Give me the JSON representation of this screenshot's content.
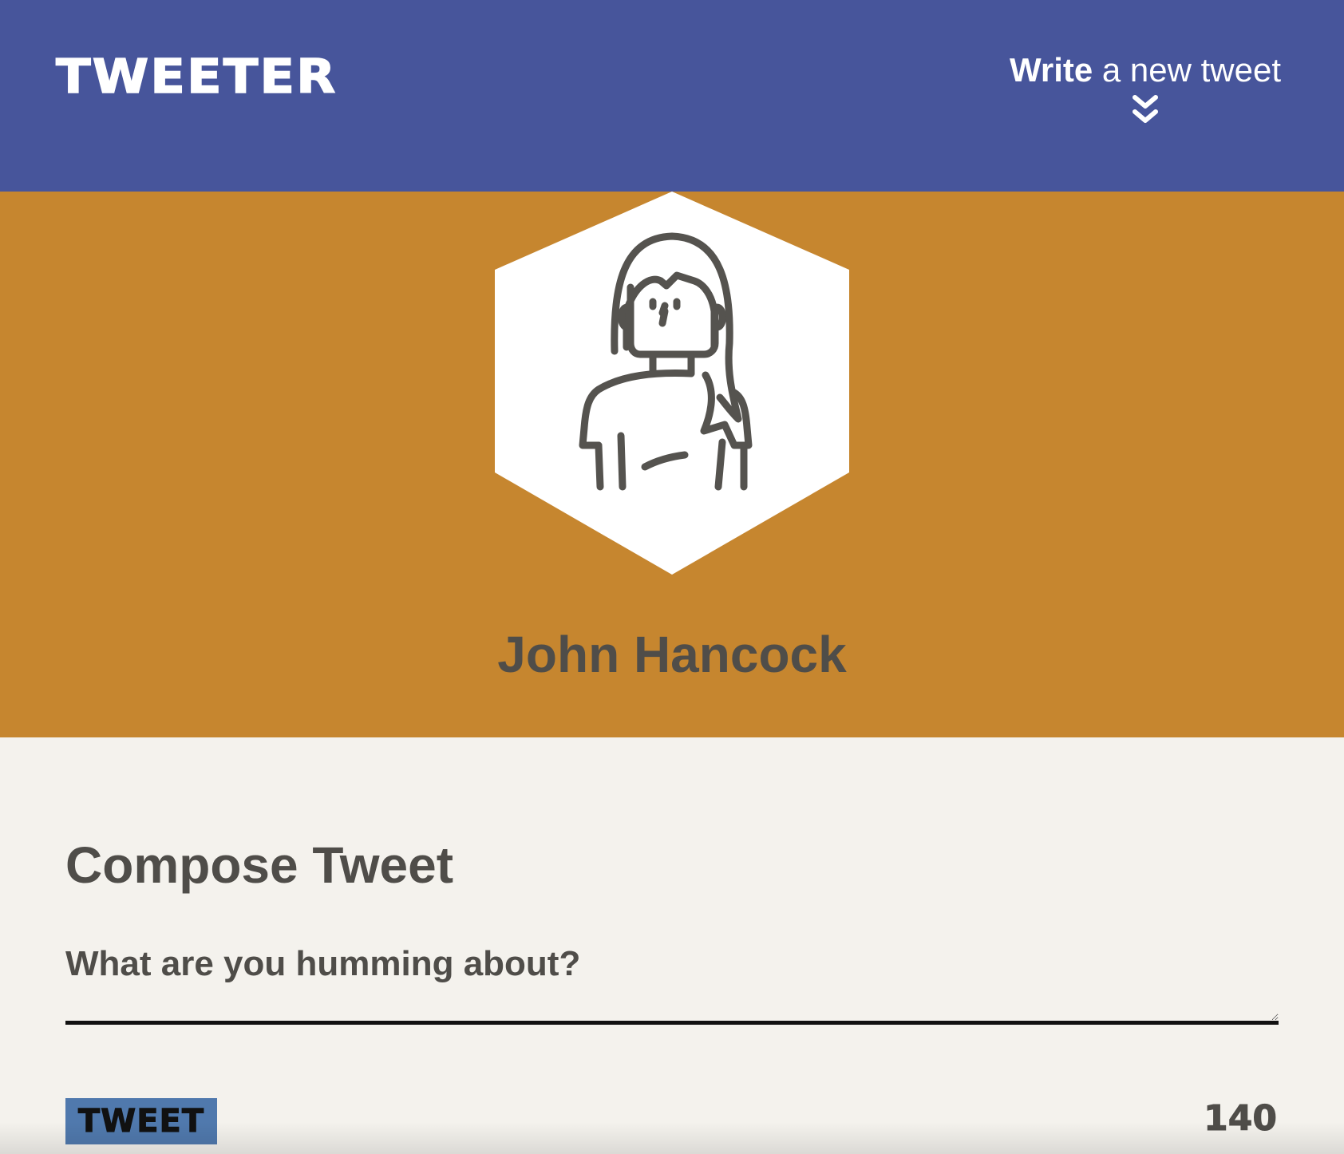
{
  "header": {
    "brand": "TWEETER",
    "write_strong": "Write",
    "write_rest": " a new tweet",
    "toggle_icon": "double-chevron-down-icon"
  },
  "profile": {
    "avatar_icon": "woman-avatar-icon",
    "name": "John Hancock"
  },
  "compose": {
    "title": "Compose Tweet",
    "placeholder": "What are you humming about?",
    "value": "",
    "submit_label": "TWEET",
    "counter": "140"
  },
  "colors": {
    "nav_background": "#47559b",
    "profile_background": "#c6862f",
    "page_background": "#f4f2ed",
    "text": "#4f4d49",
    "button_background": "#5079ad"
  }
}
